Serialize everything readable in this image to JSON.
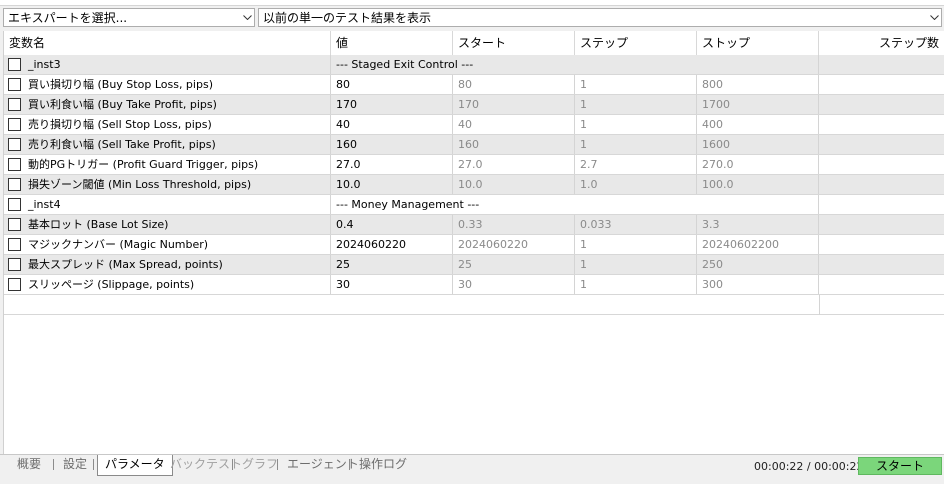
{
  "toolbar": {
    "expert_select": "エキスパートを選択...",
    "results_select": "以前の単一のテスト結果を表示"
  },
  "columns": {
    "name": "変数名",
    "value": "値",
    "start": "スタート",
    "step": "ステップ",
    "stop": "ストップ",
    "steps": "ステップ数"
  },
  "rows": [
    {
      "type": "section",
      "name": "_inst3",
      "label": "--- Staged Exit Control ---"
    },
    {
      "type": "param",
      "name": "買い損切り幅 (Buy Stop Loss, pips)",
      "value": "80",
      "start": "80",
      "step": "1",
      "stop": "800"
    },
    {
      "type": "param",
      "name": "買い利食い幅 (Buy Take Profit, pips)",
      "value": "170",
      "start": "170",
      "step": "1",
      "stop": "1700"
    },
    {
      "type": "param",
      "name": "売り損切り幅 (Sell Stop Loss, pips)",
      "value": "40",
      "start": "40",
      "step": "1",
      "stop": "400"
    },
    {
      "type": "param",
      "name": "売り利食い幅 (Sell Take Profit, pips)",
      "value": "160",
      "start": "160",
      "step": "1",
      "stop": "1600"
    },
    {
      "type": "param",
      "name": "動的PGトリガー (Profit Guard Trigger, pips)",
      "value": "27.0",
      "start": "27.0",
      "step": "2.7",
      "stop": "270.0"
    },
    {
      "type": "param",
      "name": "損失ゾーン閾値 (Min Loss Threshold, pips)",
      "value": "10.0",
      "start": "10.0",
      "step": "1.0",
      "stop": "100.0"
    },
    {
      "type": "section",
      "name": "_inst4",
      "label": "--- Money Management ---"
    },
    {
      "type": "param",
      "name": "基本ロット (Base Lot Size)",
      "value": "0.4",
      "start": "0.33",
      "step": "0.033",
      "stop": "3.3"
    },
    {
      "type": "param",
      "name": "マジックナンバー (Magic Number)",
      "value": "2024060220",
      "start": "2024060220",
      "step": "1",
      "stop": "20240602200"
    },
    {
      "type": "param",
      "name": "最大スプレッド (Max Spread, points)",
      "value": "25",
      "start": "25",
      "step": "1",
      "stop": "250"
    },
    {
      "type": "param",
      "name": "スリッページ (Slippage, points)",
      "value": "30",
      "start": "30",
      "step": "1",
      "stop": "300"
    }
  ],
  "tabs": [
    {
      "label": "概要",
      "state": "normal"
    },
    {
      "label": "設定",
      "state": "normal"
    },
    {
      "label": "パラメータ",
      "state": "active"
    },
    {
      "label": "バックテスト",
      "state": "disabled"
    },
    {
      "label": "グラフ",
      "state": "disabled"
    },
    {
      "label": "エージェント",
      "state": "normal"
    },
    {
      "label": "操作ログ",
      "state": "normal"
    }
  ],
  "status": {
    "timer": "00:00:22 / 00:00:22",
    "start_button": "スタート"
  },
  "colors": {
    "start_button": "#7bd67b",
    "row_alt": "#e8e8e8"
  }
}
